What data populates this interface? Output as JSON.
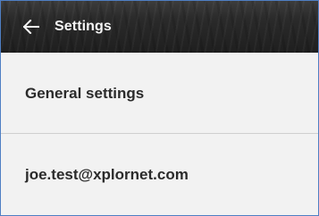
{
  "app_bar": {
    "back_icon": "arrow-left-icon",
    "title": "Settings"
  },
  "settings_list": {
    "items": [
      {
        "label": "General settings"
      },
      {
        "label": "joe.test@xplornet.com"
      }
    ]
  },
  "colors": {
    "app_bar_background": "#262626",
    "app_bar_text": "#f5f5f5",
    "list_background": "#f2f2f2",
    "item_text": "#2b2b2b",
    "divider": "#cfcfcf",
    "frame_border": "#4f7fc4"
  }
}
